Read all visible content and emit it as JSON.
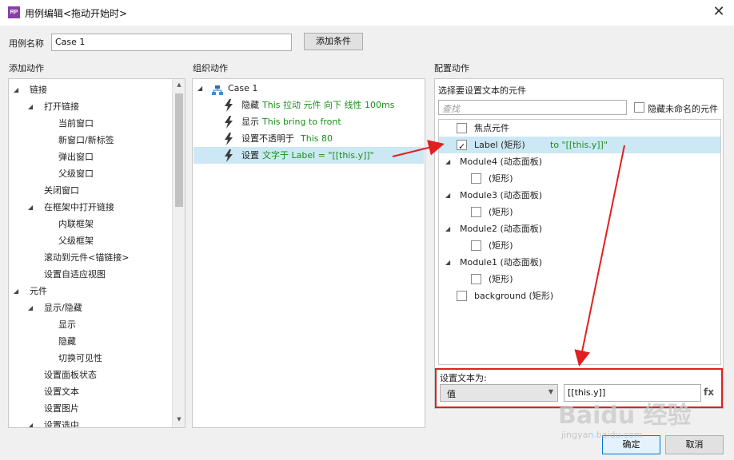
{
  "window": {
    "app_icon_text": "RP",
    "title": "用例编辑<拖动开始时>",
    "close_glyph": "✕"
  },
  "case_name": {
    "label": "用例名称",
    "value": "Case 1",
    "add_condition_label": "添加条件"
  },
  "sections": {
    "add_actions": "添加动作",
    "organize_actions": "组织动作",
    "configure_actions": "配置动作"
  },
  "add_actions_tree": [
    {
      "label": "链接",
      "level": 0,
      "expanded": true
    },
    {
      "label": "打开链接",
      "level": 1,
      "expanded": true
    },
    {
      "label": "当前窗口",
      "level": 2
    },
    {
      "label": "新窗口/新标签",
      "level": 2
    },
    {
      "label": "弹出窗口",
      "level": 2
    },
    {
      "label": "父级窗口",
      "level": 2
    },
    {
      "label": "关闭窗口",
      "level": 1
    },
    {
      "label": "在框架中打开链接",
      "level": 1,
      "expanded": true
    },
    {
      "label": "内联框架",
      "level": 2
    },
    {
      "label": "父级框架",
      "level": 2
    },
    {
      "label": "滚动到元件<锚链接>",
      "level": 1
    },
    {
      "label": "设置自适应视图",
      "level": 1
    },
    {
      "label": "元件",
      "level": 0,
      "expanded": true
    },
    {
      "label": "显示/隐藏",
      "level": 1,
      "expanded": true
    },
    {
      "label": "显示",
      "level": 2
    },
    {
      "label": "隐藏",
      "level": 2
    },
    {
      "label": "切换可见性",
      "level": 2
    },
    {
      "label": "设置面板状态",
      "level": 1
    },
    {
      "label": "设置文本",
      "level": 1
    },
    {
      "label": "设置图片",
      "level": 1
    },
    {
      "label": "设置选中",
      "level": 1,
      "expanded": true
    }
  ],
  "organize": {
    "case_label": "Case 1",
    "actions": [
      {
        "verb": "隐藏",
        "detail": "This 拉动 元件 向下 线性 100ms",
        "selected": false
      },
      {
        "verb": "显示",
        "detail": "This bring to front",
        "selected": false
      },
      {
        "verb": "设置不透明于",
        "detail": "This 80",
        "selected": false
      },
      {
        "verb": "设置",
        "detail": "文字于 Label = \"[[this.y]]\"",
        "selected": true
      }
    ]
  },
  "configure": {
    "heading": "选择要设置文本的元件",
    "search_placeholder": "查找",
    "hide_unnamed_label": "隐藏未命名的元件",
    "widgets": [
      {
        "name": "焦点元件",
        "level": 0,
        "checkbox": true,
        "checked": false,
        "suffix": ""
      },
      {
        "name": "Label (矩形)",
        "level": 0,
        "checkbox": true,
        "checked": true,
        "suffix": "to \"[[this.y]]\"",
        "highlight": true
      },
      {
        "name": "Module4 (动态面板)",
        "level": 0,
        "checkbox": false,
        "expander": true
      },
      {
        "name": "(矩形)",
        "level": 1,
        "checkbox": true,
        "checked": false
      },
      {
        "name": "Module3 (动态面板)",
        "level": 0,
        "checkbox": false,
        "expander": true
      },
      {
        "name": "(矩形)",
        "level": 1,
        "checkbox": true,
        "checked": false
      },
      {
        "name": "Module2 (动态面板)",
        "level": 0,
        "checkbox": false,
        "expander": true
      },
      {
        "name": "(矩形)",
        "level": 1,
        "checkbox": true,
        "checked": false
      },
      {
        "name": "Module1 (动态面板)",
        "level": 0,
        "checkbox": false,
        "expander": true
      },
      {
        "name": "(矩形)",
        "level": 1,
        "checkbox": true,
        "checked": false
      },
      {
        "name": "background (矩形)",
        "level": 0,
        "checkbox": true,
        "checked": false
      }
    ],
    "set_text_label": "设置文本为:",
    "value_type": "值",
    "value_text": "[[this.y]]",
    "fx_label": "fx"
  },
  "footer": {
    "ok_label": "确定",
    "cancel_label": "取消"
  },
  "watermark": {
    "main": "Baidu 经验",
    "sub": "jingyan.baidu.com"
  },
  "colors": {
    "accent_red": "#e02020",
    "action_green": "#1a8f1a",
    "selection_blue": "#cce8f4"
  }
}
